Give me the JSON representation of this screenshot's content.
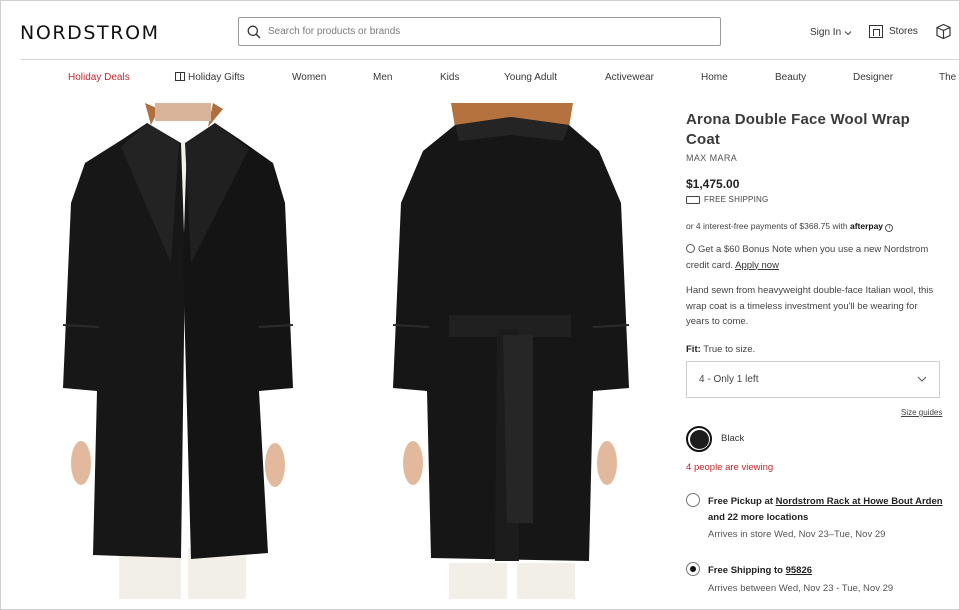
{
  "header": {
    "logo": "NORDSTROM",
    "search_placeholder": "Search for products or brands",
    "sign_in": "Sign In",
    "stores": "Stores"
  },
  "nav": [
    {
      "label": "Holiday Deals",
      "accent": "#c2272d"
    },
    {
      "label": "Holiday Gifts"
    },
    {
      "label": "Women"
    },
    {
      "label": "Men"
    },
    {
      "label": "Kids"
    },
    {
      "label": "Young Adult"
    },
    {
      "label": "Activewear"
    },
    {
      "label": "Home"
    },
    {
      "label": "Beauty"
    },
    {
      "label": "Designer"
    },
    {
      "label": "The"
    }
  ],
  "product": {
    "title": "Arona Double Face Wool Wrap Coat",
    "brand": "MAX MARA",
    "price": "$1,475.00",
    "shipping_badge": "FREE SHIPPING",
    "afterpay_text": "or 4 interest-free payments of $368.75 with",
    "afterpay_brand": "afterpay",
    "bonus_text": "Get a $60 Bonus Note when you use a new Nordstrom credit card.",
    "bonus_link": "Apply now",
    "description": "Hand sewn from heavyweight double-face Italian wool, this wrap coat is a timeless investment you'll be wearing for years to come.",
    "fit_label": "Fit:",
    "fit_value": "True to size.",
    "size_selected": "4 - Only 1 left",
    "size_guides": "Size guides",
    "color_name": "Black",
    "swatch_color": "#1d1d1d",
    "viewing_count": "4",
    "viewing_text": "people are viewing"
  },
  "fulfillment": {
    "pickup_prefix": "Free Pickup at",
    "pickup_store": "Nordstrom Rack at Howe Bout Arden",
    "pickup_more": "and 22 more locations",
    "pickup_arrives": "Arrives in store Wed, Nov 23–Tue, Nov 29",
    "ship_prefix": "Free Shipping to",
    "ship_zip": "95826",
    "ship_arrives": "Arrives between Wed, Nov 23 - Tue, Nov 29"
  }
}
